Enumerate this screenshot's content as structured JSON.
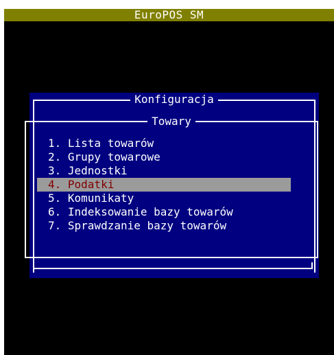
{
  "app": {
    "title": "EuroPOS SM"
  },
  "dialog": {
    "outer_title": "Konfiguracja",
    "inner_title": "Towary"
  },
  "menu": {
    "items": [
      {
        "label": "1. Lista towarów"
      },
      {
        "label": "2. Grupy towarowe"
      },
      {
        "label": "3. Jednostki"
      },
      {
        "label": "4. Podatki",
        "selected": true
      },
      {
        "label": "5. Komunikaty"
      },
      {
        "label": "6. Indeksowanie bazy towarów"
      },
      {
        "label": "7. Sprawdzanie bazy towarów"
      }
    ]
  },
  "colors": {
    "titlebar": "#808000",
    "panel": "#000080",
    "highlight_bg": "#9b9b9b",
    "highlight_fg": "#800000",
    "text": "#ffffff",
    "background": "#000000"
  }
}
